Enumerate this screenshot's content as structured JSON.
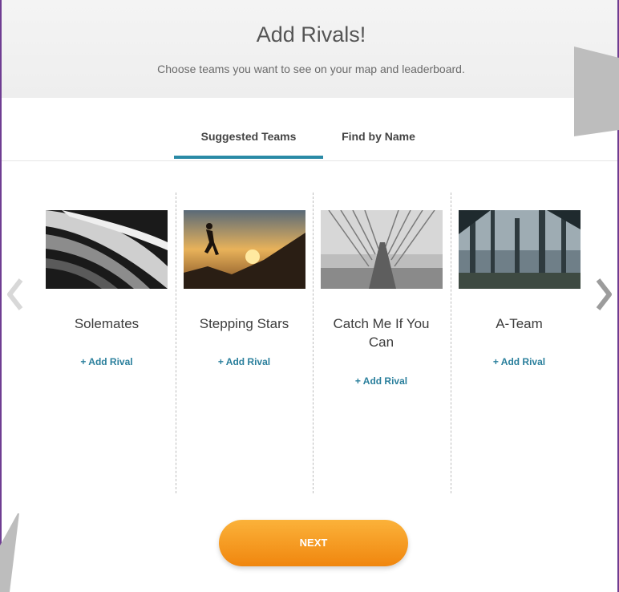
{
  "header": {
    "title": "Add Rivals!",
    "subtitle": "Choose teams you want to see on your map and leaderboard."
  },
  "tabs": [
    {
      "label": "Suggested Teams",
      "active": true
    },
    {
      "label": "Find by Name",
      "active": false
    }
  ],
  "teams": [
    {
      "name": "Solemates",
      "action": "+ Add Rival",
      "image": "spiral-structure-photo"
    },
    {
      "name": "Stepping Stars",
      "action": "+ Add Rival",
      "image": "jumping-silhouette-sunset-photo"
    },
    {
      "name": "Catch Me If You Can",
      "action": "+ Add Rival",
      "image": "bridge-cables-photo"
    },
    {
      "name": "A-Team",
      "action": "+ Add Rival",
      "image": "forest-trees-photo"
    }
  ],
  "carousel": {
    "prev_icon": "chevron-left-icon",
    "next_icon": "chevron-right-icon"
  },
  "footer": {
    "next_label": "NEXT"
  },
  "colors": {
    "accent": "#2a8aa6",
    "button_top": "#fbb23a",
    "button_bottom": "#f0860e",
    "frame": "#6f3d92"
  }
}
